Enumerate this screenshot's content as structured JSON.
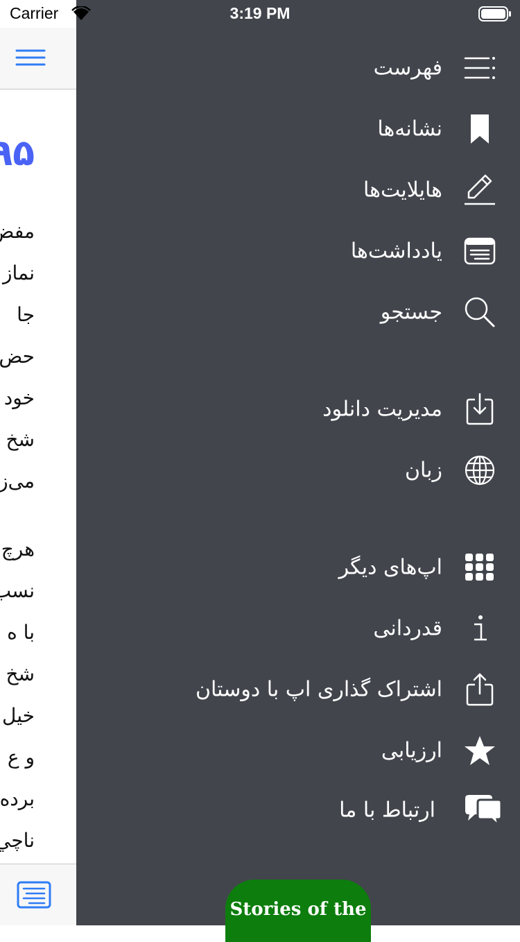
{
  "status_bar": {
    "carrier": "Carrier",
    "time": "3:19 PM"
  },
  "reader": {
    "chapter_number": "۹۵",
    "paragraph1": [
      "مفض",
      "نماز",
      "جا",
      "حض",
      "خود",
      "شخ",
      "می‌ز"
    ],
    "paragraph2": [
      "هرچ",
      "نسب",
      "با ه",
      "شخ",
      "خیل",
      "و ع",
      "برده",
      "ناچي"
    ]
  },
  "menu": {
    "items": [
      {
        "label": "فهرست",
        "icon": "list-icon"
      },
      {
        "label": "نشانه‌ها",
        "icon": "bookmark-icon"
      },
      {
        "label": "هایلایت‌ها",
        "icon": "pencil-icon"
      },
      {
        "label": "یادداشت‌ها",
        "icon": "note-icon"
      },
      {
        "label": "جستجو",
        "icon": "search-icon"
      },
      {
        "label": "مدیریت دانلود",
        "icon": "download-icon"
      },
      {
        "label": "زبان",
        "icon": "globe-icon"
      },
      {
        "label": "اپ‌های دیگر",
        "icon": "grid-icon"
      },
      {
        "label": "قدردانی",
        "icon": "info-icon"
      },
      {
        "label": "اشتراک گذاری اپ با دوستان",
        "icon": "share-icon"
      },
      {
        "label": "ارزیابی",
        "icon": "star-icon"
      },
      {
        "label": "ارتباط با ما",
        "icon": "chat-icon"
      }
    ]
  },
  "promo": {
    "text": "Stories of the"
  },
  "colors": {
    "menu_bg": "#42454c",
    "accent": "#2f7cf6",
    "chapter": "#4a63f5",
    "promo": "#0d7d0d"
  }
}
